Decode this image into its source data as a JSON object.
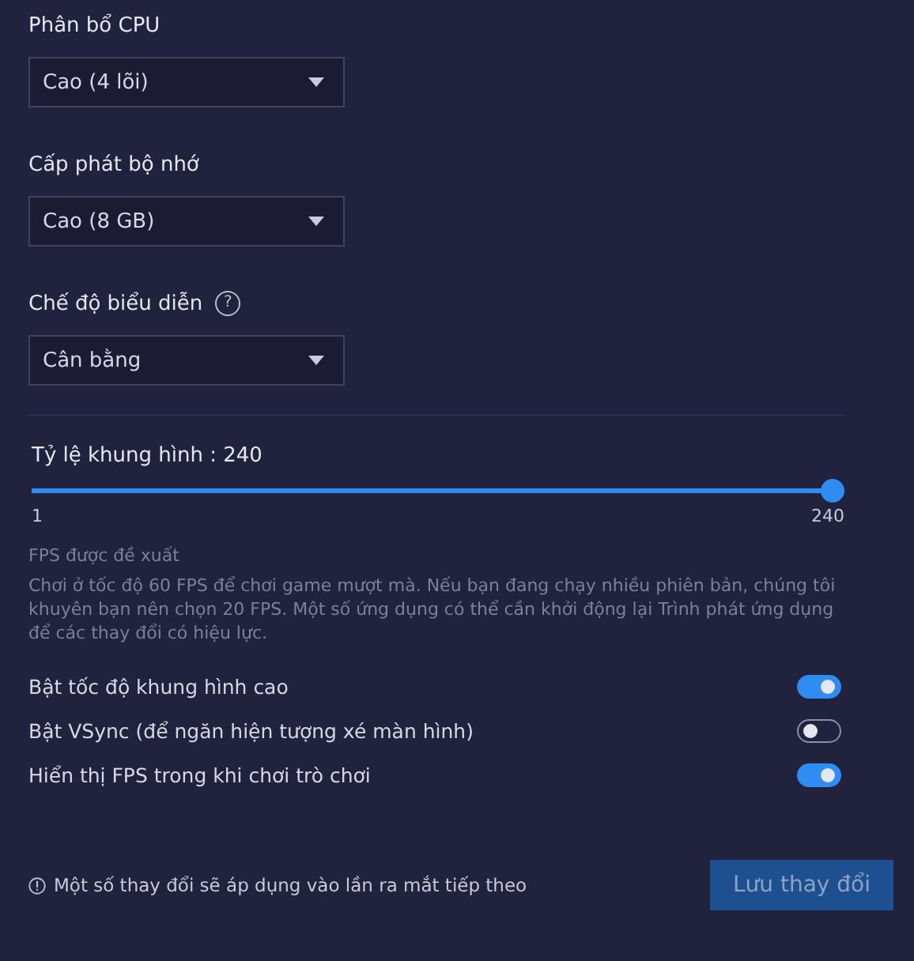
{
  "dropdowns": [
    {
      "label": "Phân bổ CPU",
      "value": "Cao (4 lõi)"
    },
    {
      "label": "Cấp phát bộ nhớ",
      "value": "Cao (8 GB)"
    },
    {
      "label": "Chế độ biểu diễn",
      "value": "Cân bằng",
      "help": "?"
    }
  ],
  "frame_rate": {
    "label": "Tỷ lệ khung hình : 240",
    "level": 1,
    "min": "1",
    "max": "240"
  },
  "recommendation": {
    "title": "FPS được đề xuất",
    "text": "Chơi ở tốc độ 60 FPS để chơi game mượt mà. Nếu bạn đang chạy nhiều phiên bản, chúng tôi khuyên bạn nên chọn 20 FPS. Một số ứng dụng có thể cần khởi động lại Trình phát ứng dụng để các thay đổi có hiệu lực."
  },
  "toggles": [
    {
      "label": "Bật tốc độ khung hình cao",
      "on": true
    },
    {
      "label": "Bật VSync (để ngăn hiện tượng xé màn hình)",
      "on": false
    },
    {
      "label": "Hiển thị FPS trong khi chơi trò chơi",
      "on": true
    }
  ],
  "footer": {
    "note": "Một số thay đổi sẽ áp dụng vào lần ra mắt tiếp theo",
    "button": {
      "label": "Lưu thay đổi",
      "disabled": true
    }
  }
}
